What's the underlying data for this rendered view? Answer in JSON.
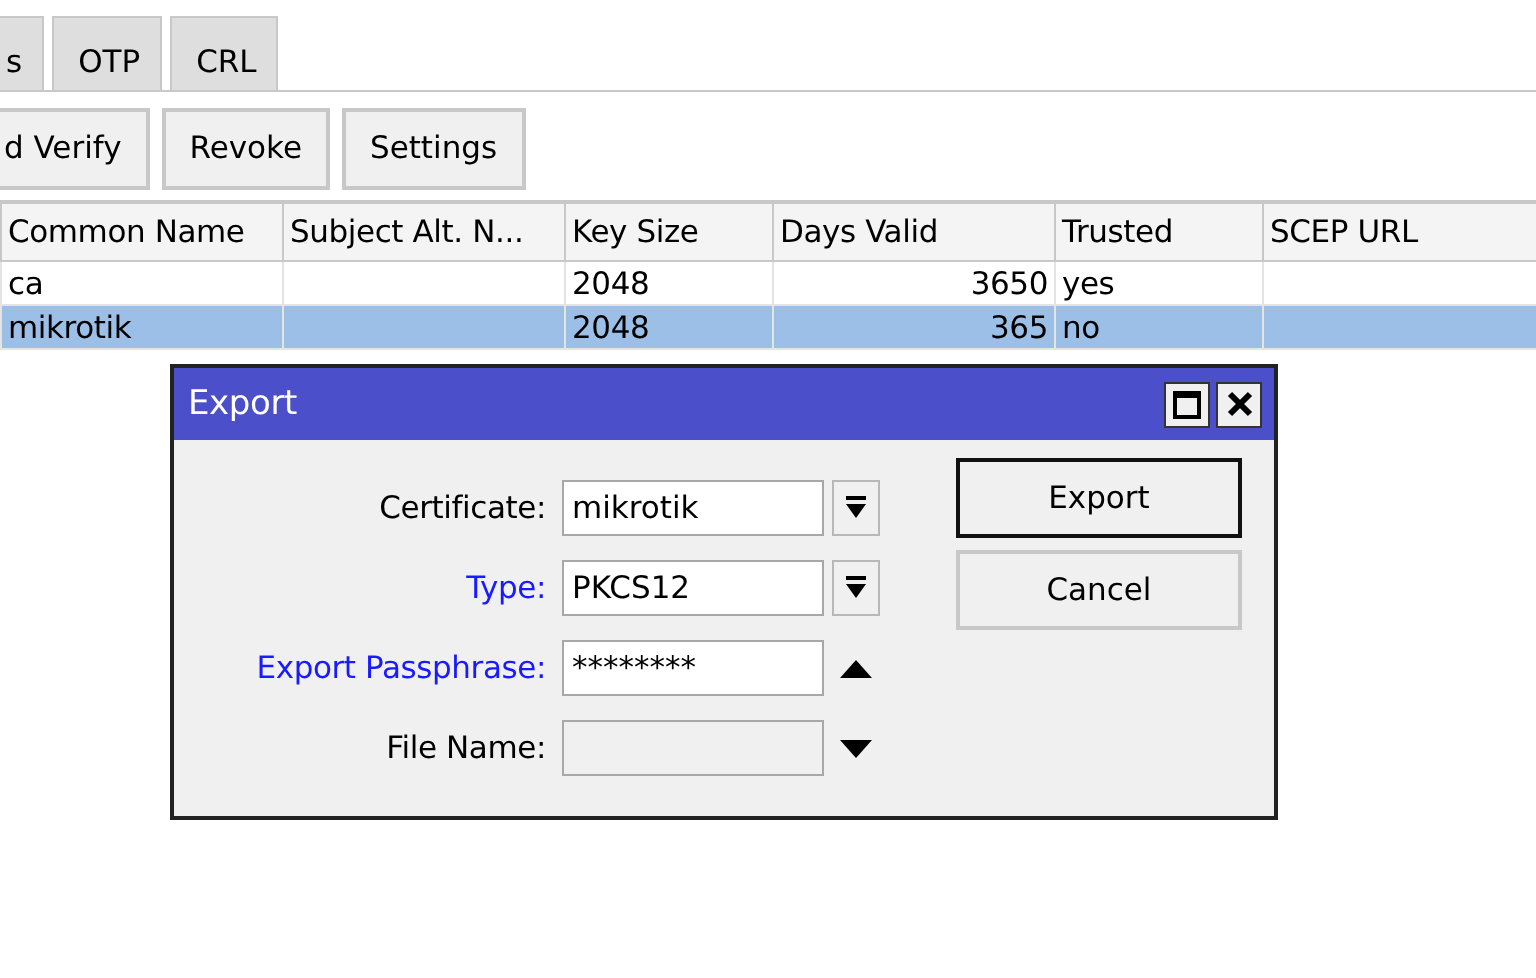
{
  "tabs": [
    {
      "label": "s",
      "selected": false
    },
    {
      "label": "OTP",
      "selected": false
    },
    {
      "label": "CRL",
      "selected": false
    }
  ],
  "toolbar": [
    "d Verify",
    "Revoke",
    "Settings"
  ],
  "table": {
    "columns": [
      "Common Name",
      "Subject Alt. N...",
      "Key Size",
      "Days Valid",
      "Trusted",
      "SCEP URL"
    ],
    "rows": [
      {
        "selected": false,
        "cells": [
          "ca",
          null,
          "2048",
          "3650",
          "yes",
          null
        ]
      },
      {
        "selected": true,
        "cells": [
          "mikrotik",
          null,
          "2048",
          "365",
          "no",
          null
        ]
      }
    ]
  },
  "dialog": {
    "title": "Export",
    "fields": [
      {
        "label": "Certificate:",
        "value": "mikrotik",
        "highlighted": false,
        "disabled": false,
        "kind": "dropdown"
      },
      {
        "label": "Type:",
        "value": "PKCS12",
        "highlighted": true,
        "disabled": false,
        "kind": "dropdown"
      },
      {
        "label": "Export Passphrase:",
        "value": "********",
        "highlighted": true,
        "disabled": false,
        "kind": "toggle",
        "expanded": true
      },
      {
        "label": "File Name:",
        "highlighted": false,
        "disabled": true,
        "kind": "toggle",
        "expanded": false
      }
    ],
    "buttons": [
      "Export",
      "Cancel"
    ]
  }
}
